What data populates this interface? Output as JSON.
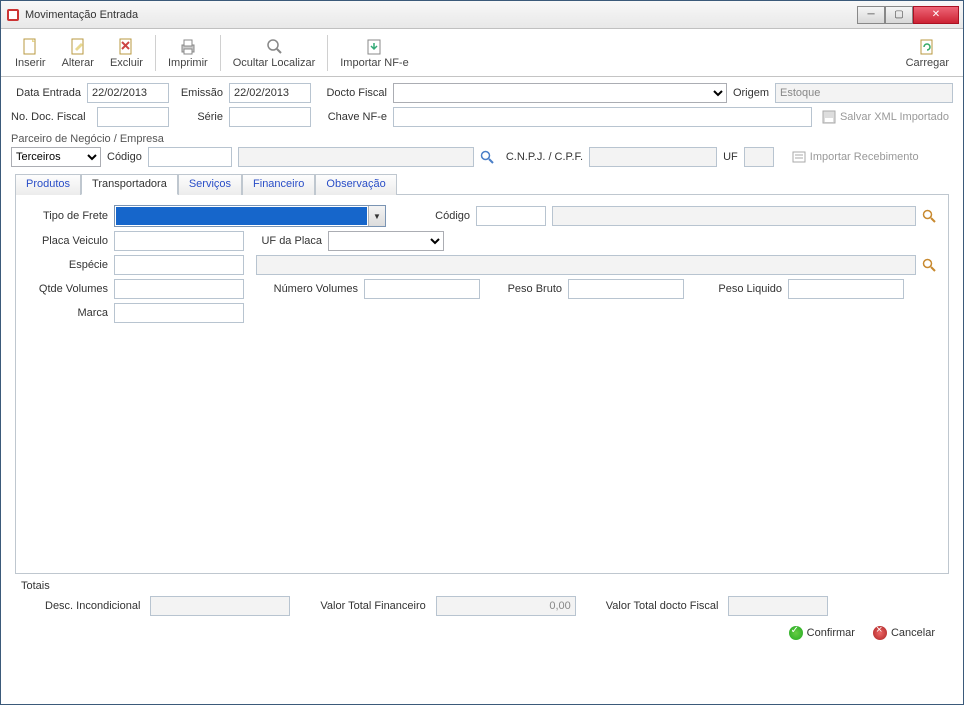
{
  "window": {
    "title": "Movimentação Entrada"
  },
  "toolbar": {
    "inserir": "Inserir",
    "alterar": "Alterar",
    "excluir": "Excluir",
    "imprimir": "Imprimir",
    "ocultar_localizar": "Ocultar Localizar",
    "importar_nfe": "Importar NF-e",
    "carregar": "Carregar"
  },
  "header": {
    "data_entrada_lbl": "Data Entrada",
    "data_entrada_val": "22/02/2013",
    "emissao_lbl": "Emissão",
    "emissao_val": "22/02/2013",
    "docto_fiscal_lbl": "Docto Fiscal",
    "docto_fiscal_val": "",
    "origem_lbl": "Origem",
    "origem_val": "Estoque",
    "no_doc_lbl": "No. Doc. Fiscal",
    "no_doc_val": "",
    "serie_lbl": "Série",
    "serie_val": "",
    "chave_nfe_lbl": "Chave NF-e",
    "chave_nfe_val": "",
    "salvar_xml_lbl": "Salvar XML Importado"
  },
  "parceiro": {
    "group_lbl": "Parceiro de Negócio / Empresa",
    "tipo_val": "Terceiros",
    "codigo_lbl": "Código",
    "codigo_val": "",
    "nome_val": "",
    "cnpj_lbl": "C.N.P.J. / C.P.F.",
    "cnpj_val": "",
    "uf_lbl": "UF",
    "uf_val": "",
    "importar_receb_lbl": "Importar Recebimento"
  },
  "tabs": {
    "produtos": "Produtos",
    "transportadora": "Transportadora",
    "servicos": "Serviços",
    "financeiro": "Financeiro",
    "observacao": "Observação",
    "active": "transportadora"
  },
  "transp": {
    "tipo_frete_lbl": "Tipo de Frete",
    "tipo_frete_val": "",
    "codigo_lbl": "Código",
    "codigo_val": "",
    "nome_val": "",
    "placa_lbl": "Placa Veiculo",
    "placa_val": "",
    "uf_placa_lbl": "UF da Placa",
    "uf_placa_val": "",
    "especie_lbl": "Espécie",
    "especie_val": "",
    "especie_desc_val": "",
    "qtde_vol_lbl": "Qtde Volumes",
    "qtde_vol_val": "",
    "num_vol_lbl": "Número Volumes",
    "num_vol_val": "",
    "peso_bruto_lbl": "Peso Bruto",
    "peso_bruto_val": "",
    "peso_liq_lbl": "Peso Liquido",
    "peso_liq_val": "",
    "marca_lbl": "Marca",
    "marca_val": ""
  },
  "totais": {
    "group_lbl": "Totais",
    "desc_lbl": "Desc. Incondicional",
    "desc_val": "",
    "valor_fin_lbl": "Valor Total Financeiro",
    "valor_fin_val": "0,00",
    "valor_docto_lbl": "Valor Total docto Fiscal",
    "valor_docto_val": ""
  },
  "footer": {
    "confirmar": "Confirmar",
    "cancelar": "Cancelar"
  }
}
